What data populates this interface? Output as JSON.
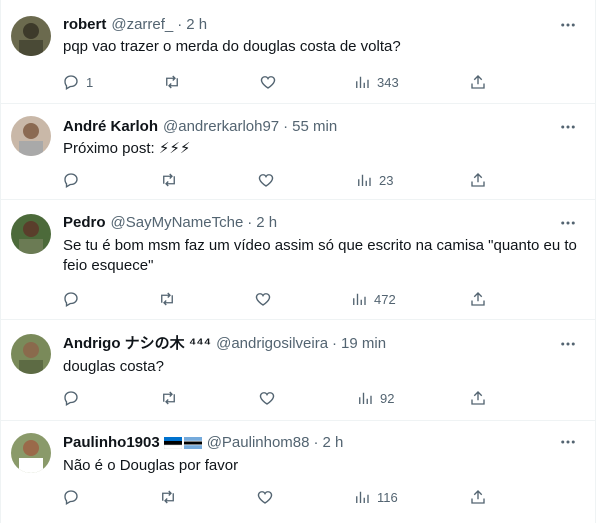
{
  "tweets": [
    {
      "name": "robert",
      "handle": "@zarref_",
      "sep": "·",
      "time": "2 h",
      "text": "pqp vao trazer o merda do douglas costa de volta?",
      "counts": {
        "replies": "1",
        "retweets": "",
        "likes": "",
        "views": "343"
      }
    },
    {
      "name": "André Karloh",
      "handle": "@andrerkarloh97",
      "sep": "·",
      "time": "55 min",
      "text": "Próximo post: ⚡⚡⚡",
      "counts": {
        "replies": "",
        "retweets": "",
        "likes": "",
        "views": "23"
      }
    },
    {
      "name": "Pedro",
      "handle": "@SayMyNameTche",
      "sep": "·",
      "time": "2 h",
      "text": "Se tu é bom msm faz um vídeo assim só que escrito na camisa \"quanto eu to feio esquece\"",
      "counts": {
        "replies": "",
        "retweets": "",
        "likes": "",
        "views": "472"
      }
    },
    {
      "name": "Andrigo ナシの木 ⁴⁴⁴",
      "handle": "@andrigosilveira",
      "sep": "·",
      "time": "19 min",
      "text": "douglas costa?",
      "counts": {
        "replies": "",
        "retweets": "",
        "likes": "",
        "views": "92"
      }
    },
    {
      "name": "Paulinho1903",
      "handle": "@Paulinhom88",
      "sep": "·",
      "time": "2 h",
      "text": "Não é o Douglas por favor",
      "counts": {
        "replies": "",
        "retweets": "",
        "likes": "",
        "views": "116"
      }
    }
  ],
  "colors": {
    "text_primary": "#0f1419",
    "text_secondary": "#536471",
    "divider": "#eff3f4"
  },
  "icons": [
    "reply-icon",
    "retweet-icon",
    "like-icon",
    "views-icon",
    "share-icon",
    "more-options-icon"
  ]
}
